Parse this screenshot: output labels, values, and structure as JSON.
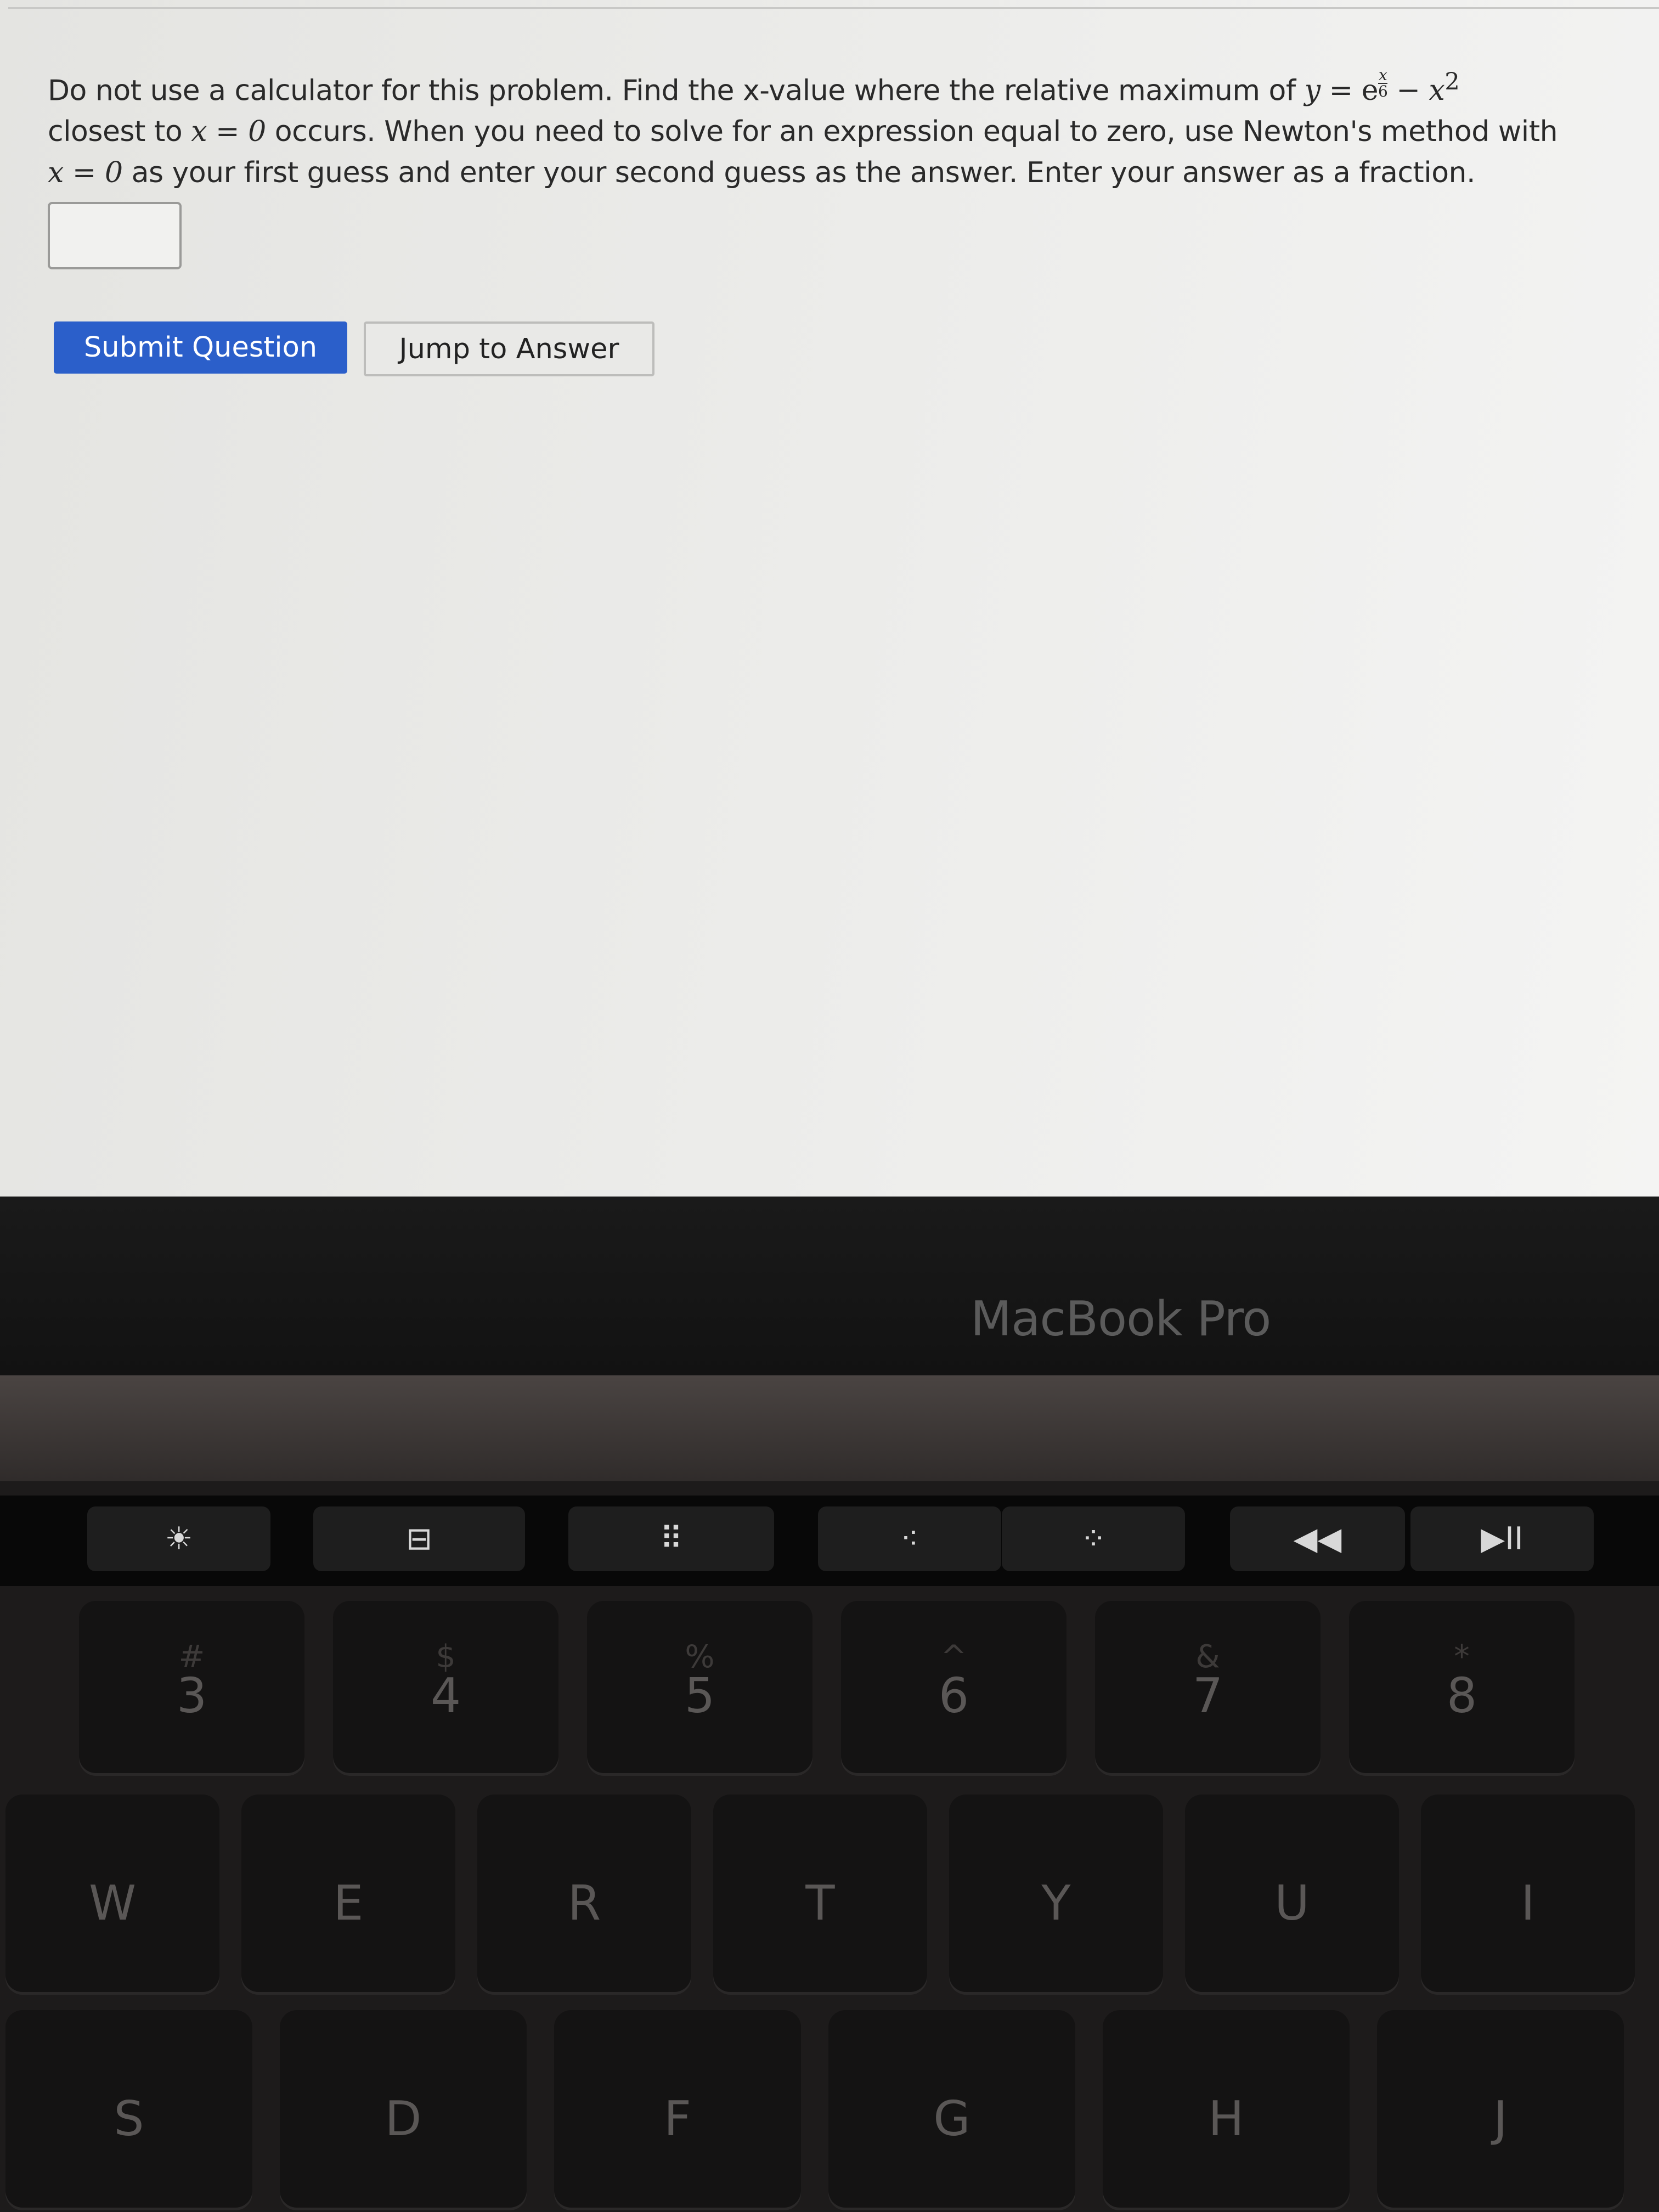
{
  "question": {
    "part1": "Do not use a calculator for this problem. Find the x-value where the relative maximum of ",
    "func_y": "y",
    "func_eq": " = e",
    "func_exp_num": "x",
    "func_exp_den": "6",
    "func_rest": " − x",
    "func_pow": "2",
    "part2": "closest to ",
    "x_eq_0": "x = 0",
    "part3": " occurs. When you need to solve for an expression equal to zero, use Newton's method with",
    "part4": " as your first guess and enter your second guess as the answer. Enter your answer as a fraction."
  },
  "answer": {
    "value": ""
  },
  "buttons": {
    "submit": "Submit Question",
    "jump": "Jump to Answer"
  },
  "laptop": {
    "brand": "MacBook Pro"
  },
  "touchbar": [
    {
      "icon": "brightness-up-icon",
      "glyph": "☀"
    },
    {
      "icon": "mission-control-icon",
      "glyph": "⊟"
    },
    {
      "icon": "launchpad-icon",
      "glyph": "⠿"
    },
    {
      "icon": "keyboard-brightness-down-icon",
      "glyph": "⁖"
    },
    {
      "icon": "keyboard-brightness-up-icon",
      "glyph": "⁘"
    },
    {
      "icon": "rewind-icon",
      "glyph": "◀◀"
    },
    {
      "icon": "play-pause-icon",
      "glyph": "▶II"
    }
  ],
  "keys": {
    "row1": [
      {
        "main": "3",
        "sub": "#"
      },
      {
        "main": "4",
        "sub": "$"
      },
      {
        "main": "5",
        "sub": "%"
      },
      {
        "main": "6",
        "sub": "^"
      },
      {
        "main": "7",
        "sub": "&"
      },
      {
        "main": "8",
        "sub": "*"
      }
    ],
    "row2": [
      "W",
      "E",
      "R",
      "T",
      "Y",
      "U",
      "I"
    ],
    "row3": [
      "S",
      "D",
      "F",
      "G",
      "H",
      "J"
    ]
  },
  "colors": {
    "submit_bg": "#2b5fca",
    "page_bg": "#ececea"
  }
}
